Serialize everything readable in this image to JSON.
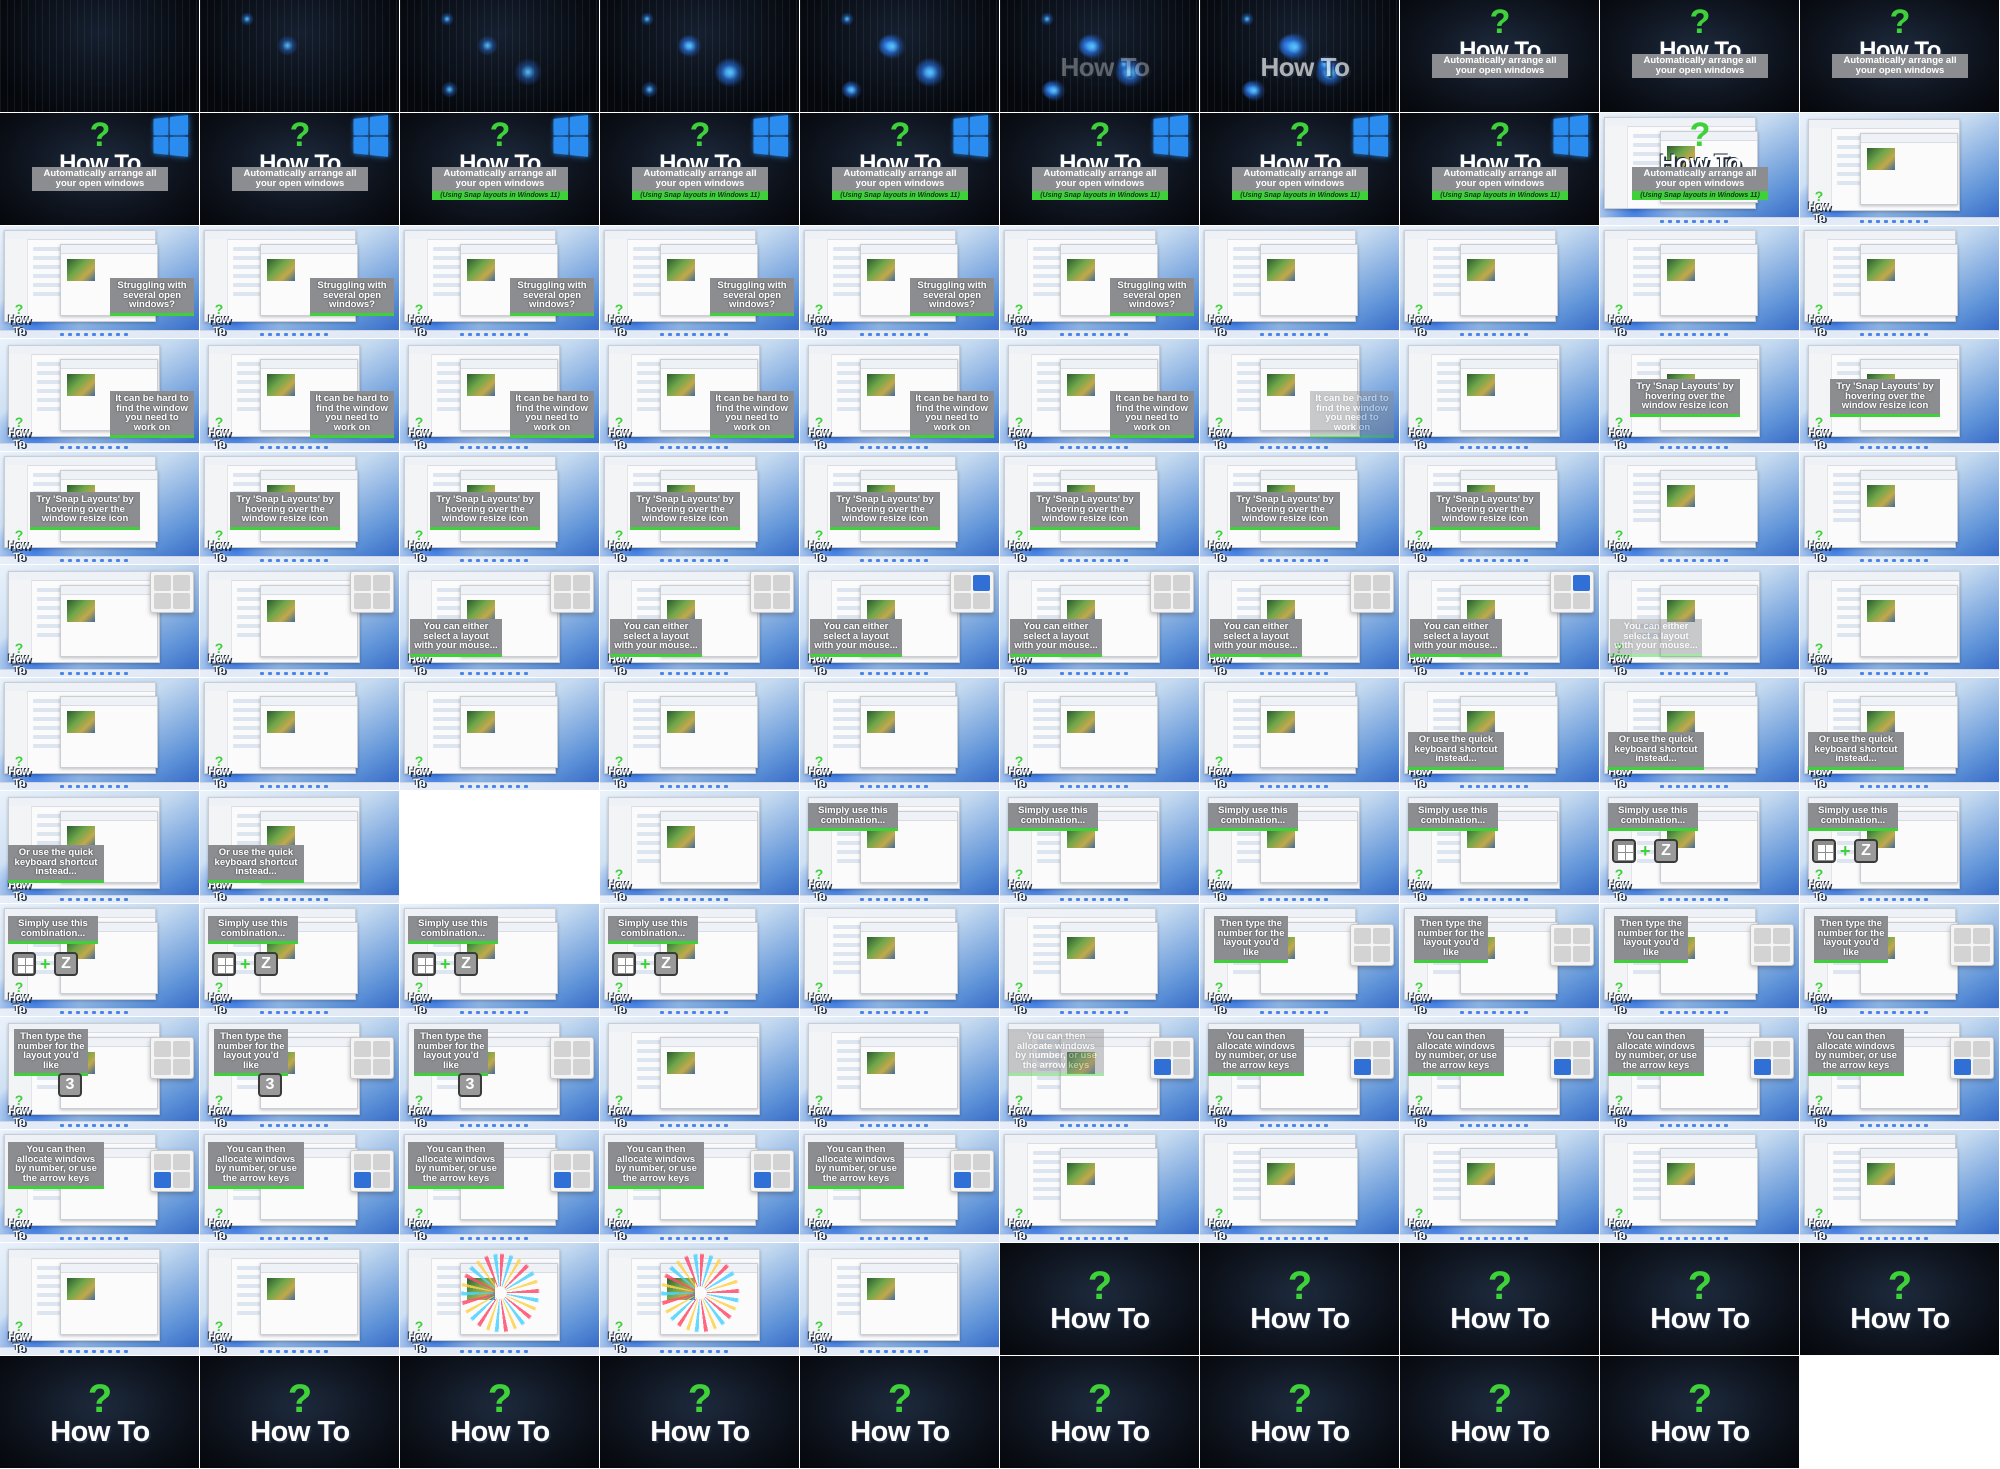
{
  "brand": {
    "logo_text": "How To",
    "accent_green": "#3fd13a",
    "caption_grey": "#8b8d90",
    "dark_bg": "#0b0f17"
  },
  "intro": {
    "headline": "Automatically arrange all your open windows",
    "subline": "(Using Snap layouts in Windows 11)"
  },
  "captions": {
    "struggling": "Struggling with several open windows?",
    "hard_to_find": "It can be hard to find the window you need to work on",
    "try_snap": "Try 'Snap Layouts' by hovering over the window resize icon",
    "either_select": "You can either select a layout with your mouse...",
    "or_shortcut": "Or use the quick keyboard shortcut instead...",
    "simply_use": "Simply use this combination...",
    "then_type": "Then type the number for the layout you'd like",
    "allocate": "You can then allocate windows by number, or use the arrow keys"
  },
  "keys": {
    "plus": "+",
    "z": "Z",
    "three": "3"
  },
  "sheet": {
    "columns": 10,
    "rows": 13,
    "frame_count": 129
  }
}
